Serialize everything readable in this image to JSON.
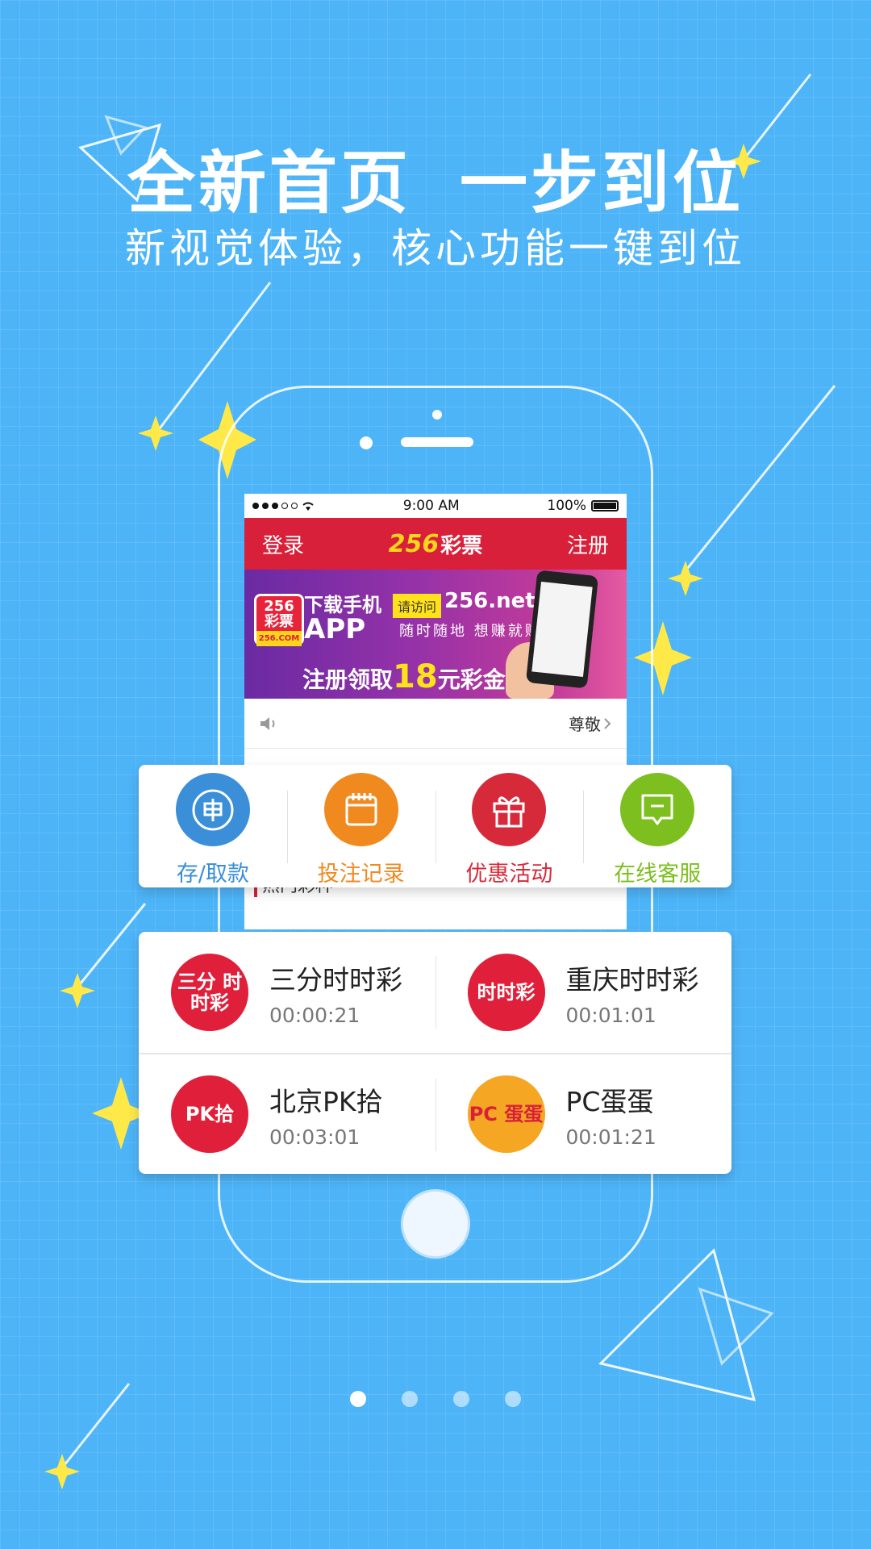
{
  "headline": {
    "part1": "全新首页",
    "part2": "一步到位"
  },
  "subline": "新视觉体验，核心功能一键到位",
  "status_bar": {
    "time": "9:00 AM",
    "battery": "100%"
  },
  "app_header": {
    "login": "登录",
    "logo_number": "256",
    "logo_text": "彩票",
    "register": "注册"
  },
  "banner": {
    "logo_line1": "256",
    "logo_line2": "彩票",
    "logo_domain": "256.COM",
    "download_text": "下载手机",
    "app_text": "APP",
    "visit_label": "请访问",
    "url": "256.net",
    "slogan": "随时随地 想赚就赚",
    "promo_prefix": "注册领取",
    "promo_amount": "18",
    "promo_suffix": "元彩金"
  },
  "notice": {
    "text": "尊敬"
  },
  "section_title": "热门彩种",
  "quick_actions": [
    {
      "label": "存/取款",
      "color": "#3a8fd8",
      "icon": "wallet-icon"
    },
    {
      "label": "投注记录",
      "color": "#f08a1f",
      "icon": "calendar-icon"
    },
    {
      "label": "优惠活动",
      "color": "#d62a3a",
      "icon": "gift-icon"
    },
    {
      "label": "在线客服",
      "color": "#7cbf1e",
      "icon": "chat-icon"
    }
  ],
  "lotteries": [
    {
      "name": "三分时时彩",
      "time": "00:00:21",
      "icon_text": "三分 时时彩",
      "color": "#e0203a"
    },
    {
      "name": "重庆时时彩",
      "time": "00:01:01",
      "icon_text": "时时彩",
      "color": "#e0203a"
    },
    {
      "name": "北京PK拾",
      "time": "00:03:01",
      "icon_text": "PK拾",
      "color": "#e0203a"
    },
    {
      "name": "PC蛋蛋",
      "time": "00:01:21",
      "icon_text": "PC 蛋蛋",
      "color": "#f5a623"
    }
  ],
  "pager": {
    "total": 4,
    "active_index": 0
  },
  "colors": {
    "background": "#4db4f8",
    "header_red": "#d9203a",
    "star_yellow": "#ffe948"
  }
}
